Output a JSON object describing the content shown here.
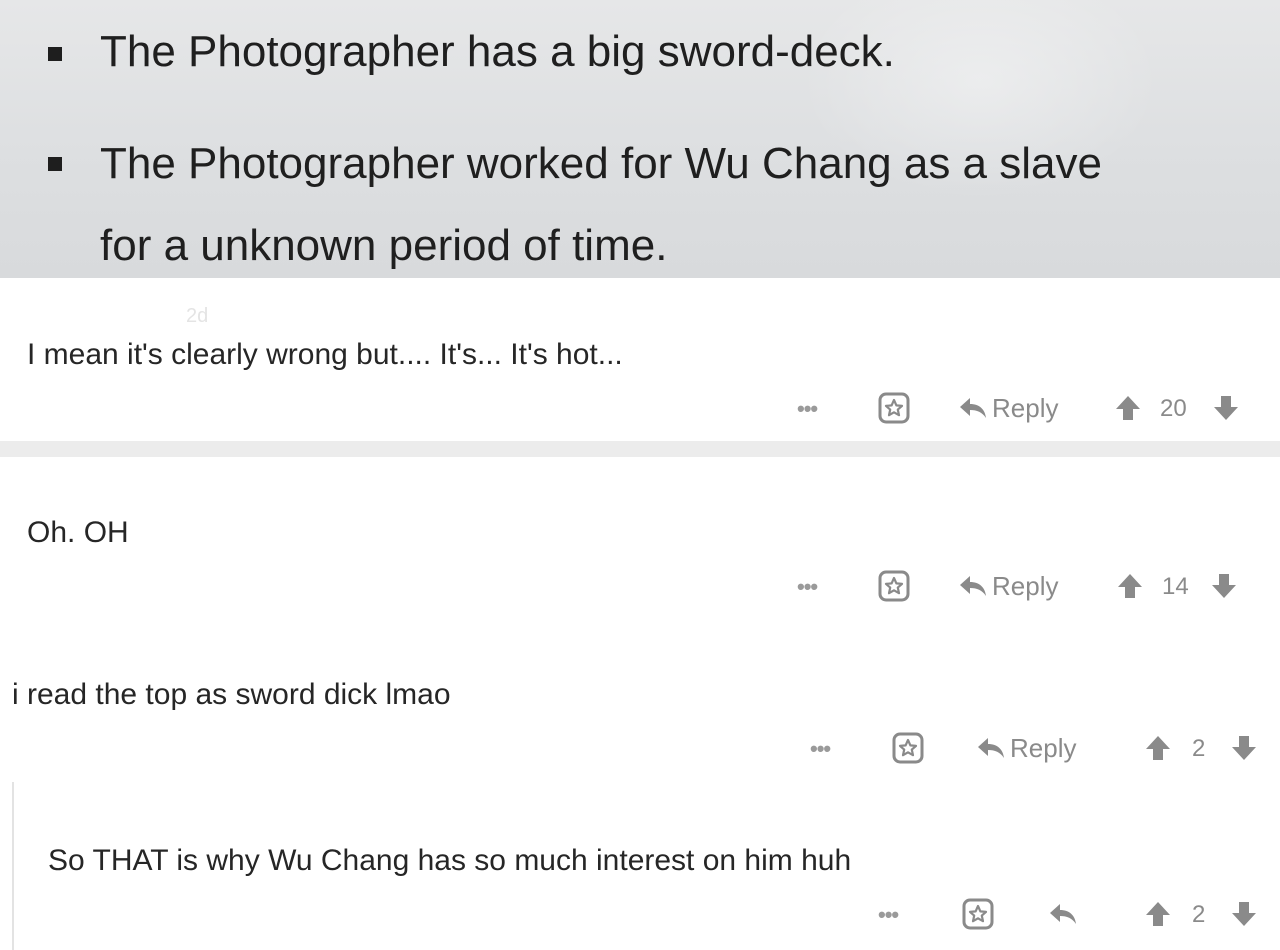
{
  "post": {
    "bullets": [
      {
        "line1": "The Photographer has a big sword-deck.",
        "line2": ""
      },
      {
        "line1": "The Photographer worked for Wu Chang as a slave",
        "line2": "for a unknown period of time."
      }
    ]
  },
  "comments": [
    {
      "meta": "2d",
      "text": "I mean it's clearly wrong but.... It's... It's hot...",
      "more": "•••",
      "reply_label": "Reply",
      "votes": "20"
    },
    {
      "meta": "",
      "text": "Oh. OH",
      "more": "•••",
      "reply_label": "Reply",
      "votes": "14"
    },
    {
      "meta": "",
      "text": "i read the top as sword dick lmao",
      "more": "•••",
      "reply_label": "Reply",
      "votes": "2"
    },
    {
      "meta": "",
      "text": "So THAT is why Wu Chang has so much interest on him huh",
      "more": "•••",
      "reply_label": "",
      "votes": "2"
    }
  ],
  "colors": {
    "icon_gray": "#8a8a8a",
    "divider": "#ececec"
  },
  "icons": [
    "star-icon",
    "reply-arrow-icon",
    "upvote-arrow-icon",
    "downvote-arrow-icon",
    "more-options-icon"
  ]
}
